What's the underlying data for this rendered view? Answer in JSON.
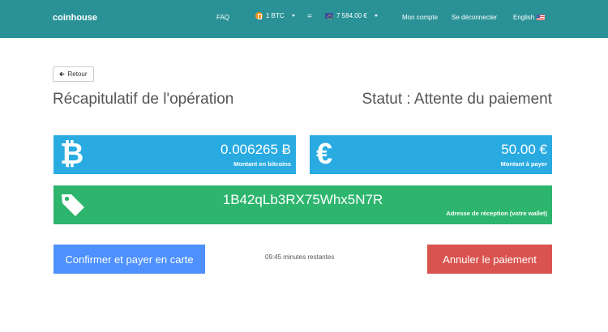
{
  "header": {
    "brand": "coinhouse",
    "faq": "FAQ",
    "btc_select": "1 BTC",
    "equals": "=",
    "eur_select": "7 584.00 €",
    "account": "Mon compte",
    "logout": "Se déconnecter",
    "language": "English"
  },
  "back_button": {
    "label": "Retour",
    "icon": "arrow-left-icon"
  },
  "titles": {
    "summary": "Récapitulatif de l'opération",
    "status": "Statut : Attente du paiement"
  },
  "panels": {
    "btc": {
      "icon": "₿",
      "value": "0.006265 Ƀ",
      "caption": "Montant en bitcoins",
      "color": "#29abe2"
    },
    "eur": {
      "icon": "€",
      "value": "50.00 €",
      "caption": "Montant à payer",
      "color": "#29abe2"
    },
    "address": {
      "icon": "tag-icon",
      "value": "1B42qLb3RX75Whx5N7R",
      "caption": "Adresse de réception (votre wallet)",
      "color": "#2db56e"
    }
  },
  "actions": {
    "confirm": "Confirmer et payer en carte",
    "timer": "09:45 minutes restantes",
    "cancel": "Annuler le paiement"
  },
  "colors": {
    "navbar": "#2a9297",
    "confirm": "#4d90fe",
    "cancel": "#d9534f"
  }
}
